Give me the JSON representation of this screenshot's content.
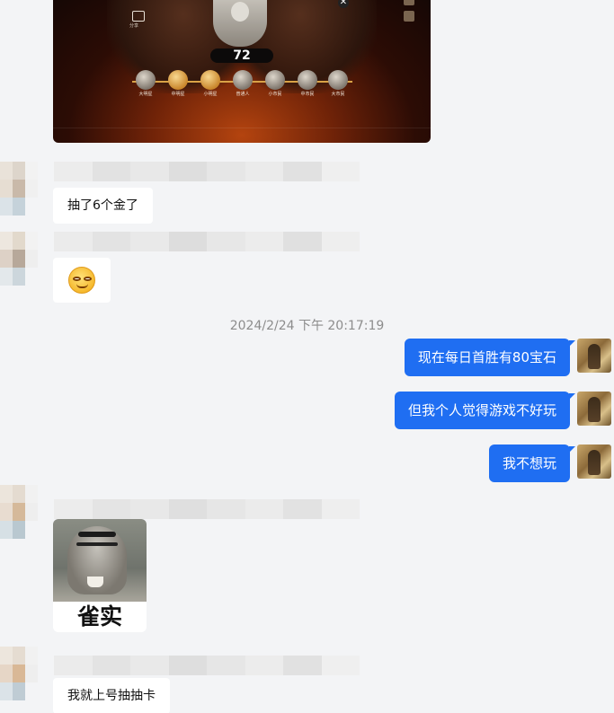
{
  "game_image": {
    "score": "72",
    "share_label": "分享",
    "tiers": [
      "大明星",
      "中明星",
      "小明星",
      "普通人",
      "小市民",
      "中市民",
      "大市民"
    ]
  },
  "messages": {
    "m1_text": "抽了6个金了",
    "timestamp": "2024/2/24 下午 20:17:19",
    "out1": "现在每日首胜有80宝石",
    "out2": "但我个人觉得游戏不好玩",
    "out3": "我不想玩",
    "sticker_caption": "雀实",
    "m_last": "我就上号抽抽卡"
  },
  "colors": {
    "outgoing_bubble": "#1f6ef2",
    "incoming_bubble": "#ffffff",
    "background": "#f3f4f6"
  },
  "icons": [
    "share-icon",
    "close-icon",
    "smiley-emoji",
    "bird-sticker",
    "self-avatar",
    "blurred-avatar"
  ]
}
